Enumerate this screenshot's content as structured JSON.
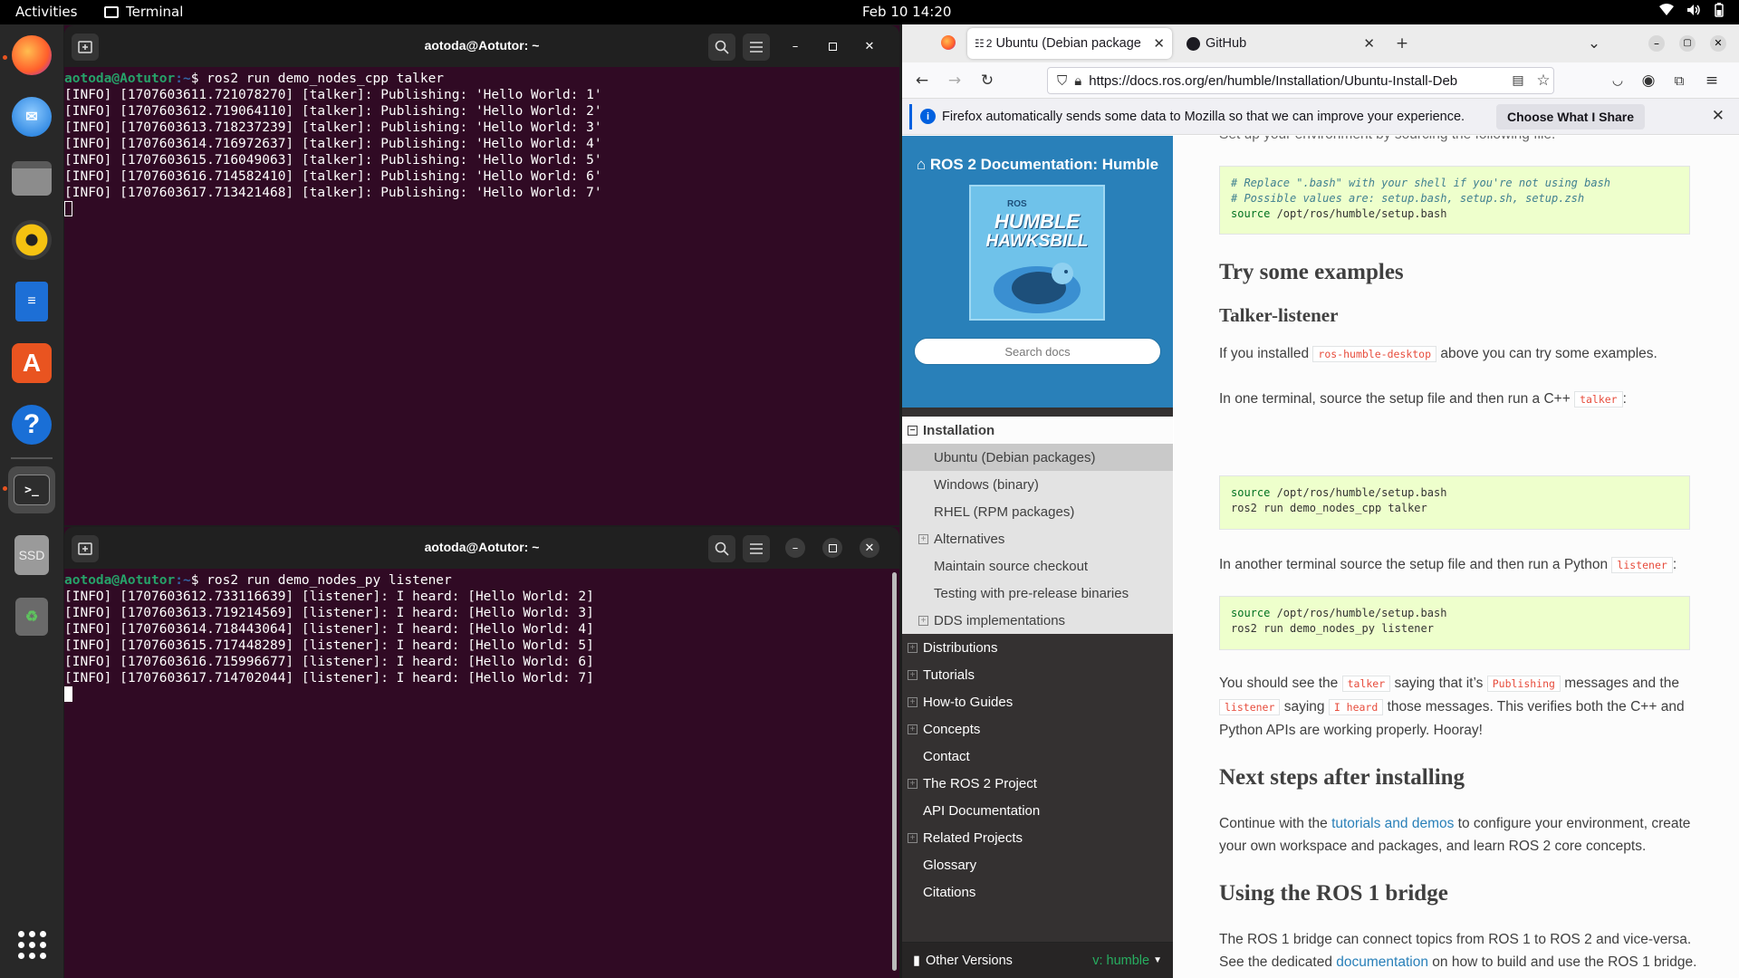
{
  "topbar": {
    "activities": "Activities",
    "app_name": "Terminal",
    "clock": "Feb 10  14:20"
  },
  "terminal_top": {
    "title": "aotoda@Aotutor: ~",
    "prompt_user": "aotoda@Aotutor",
    "prompt_path": ":~",
    "command": "$ ros2 run demo_nodes_cpp talker",
    "lines": [
      "[INFO] [1707603611.721078270] [talker]: Publishing: 'Hello World: 1'",
      "[INFO] [1707603612.719064110] [talker]: Publishing: 'Hello World: 2'",
      "[INFO] [1707603613.718237239] [talker]: Publishing: 'Hello World: 3'",
      "[INFO] [1707603614.716972637] [talker]: Publishing: 'Hello World: 4'",
      "[INFO] [1707603615.716049063] [talker]: Publishing: 'Hello World: 5'",
      "[INFO] [1707603616.714582410] [talker]: Publishing: 'Hello World: 6'",
      "[INFO] [1707603617.713421468] [talker]: Publishing: 'Hello World: 7'"
    ]
  },
  "terminal_bottom": {
    "title": "aotoda@Aotutor: ~",
    "prompt_user": "aotoda@Aotutor",
    "prompt_path": ":~",
    "command": "$ ros2 run demo_nodes_py listener",
    "lines": [
      "[INFO] [1707603612.733116639] [listener]: I heard: [Hello World: 2]",
      "[INFO] [1707603613.719214569] [listener]: I heard: [Hello World: 3]",
      "[INFO] [1707603614.718443064] [listener]: I heard: [Hello World: 4]",
      "[INFO] [1707603615.717448289] [listener]: I heard: [Hello World: 5]",
      "[INFO] [1707603616.715996677] [listener]: I heard: [Hello World: 6]",
      "[INFO] [1707603617.714702044] [listener]: I heard: [Hello World: 7]"
    ]
  },
  "browser": {
    "tab1_label": "Ubuntu (Debian package",
    "tab1_badge": "2",
    "tab2_label": "GitHub",
    "url": "https://docs.ros.org/en/humble/Installation/Ubuntu-Install-Deb",
    "notification": "Firefox automatically sends some data to Mozilla so that we can improve your experience.",
    "notification_button": "Choose What I Share"
  },
  "sidebar": {
    "brand": "ROS 2 Documentation: Humble",
    "logo_small": "ROS",
    "logo_line1": "HUMBLE",
    "logo_line2": "HAWKSBILL",
    "search_placeholder": "Search docs",
    "installation": "Installation",
    "sub_items": [
      "Ubuntu (Debian packages)",
      "Windows (binary)",
      "RHEL (RPM packages)",
      "Alternatives",
      "Maintain source checkout",
      "Testing with pre-release binaries",
      "DDS implementations"
    ],
    "top_items": [
      "Distributions",
      "Tutorials",
      "How-to Guides",
      "Concepts",
      "Contact",
      "The ROS 2 Project",
      "API Documentation",
      "Related Projects",
      "Glossary",
      "Citations"
    ],
    "other_versions": "Other Versions",
    "version": "v: humble"
  },
  "content": {
    "cut_text": "Set up your environment by sourcing the following file.",
    "code1": {
      "c1": "# Replace \".bash\" with your shell if you're not using bash",
      "c2": "# Possible values are: setup.bash, setup.sh, setup.zsh",
      "kw": "source",
      "rest": " /opt/ros/humble/setup.bash"
    },
    "h_try": "Try some examples",
    "h_talker": "Talker-listener",
    "p1_a": "If you installed ",
    "p1_lit": "ros-humble-desktop",
    "p1_b": " above you can try some examples.",
    "p2_a": "In one terminal, source the setup file and then run a C++ ",
    "p2_lit": "talker",
    "p2_b": ":",
    "code2": {
      "kw": "source",
      "l1": " /opt/ros/humble/setup.bash",
      "l2": "ros2 run demo_nodes_cpp talker"
    },
    "p3_a": "In another terminal source the setup file and then run a Python ",
    "p3_lit": "listener",
    "p3_b": ":",
    "code3": {
      "kw": "source",
      "l1": " /opt/ros/humble/setup.bash",
      "l2": "ros2 run demo_nodes_py listener"
    },
    "p4_a": "You should see the ",
    "p4_lit1": "talker",
    "p4_b": " saying that it’s ",
    "p4_lit2": "Publishing",
    "p4_c": " messages and the ",
    "p4_lit3": "listener",
    "p4_d": " saying ",
    "p4_lit4": "I heard",
    "p4_e": " those messages. This verifies both the C++ and Python APIs are working properly. Hooray!",
    "h_next": "Next steps after installing",
    "p5_a": "Continue with the ",
    "p5_link": "tutorials and demos",
    "p5_b": " to configure your environment, create your own workspace and packages, and learn ROS 2 core concepts.",
    "h_bridge": "Using the ROS 1 bridge",
    "p6_a": "The ROS 1 bridge can connect topics from ROS 1 to ROS 2 and vice-versa. See the dedicated ",
    "p6_link": "documentation",
    "p6_b": " on how to build and use the ROS 1 bridge."
  },
  "dock": {
    "ssd_label": "SSD"
  }
}
